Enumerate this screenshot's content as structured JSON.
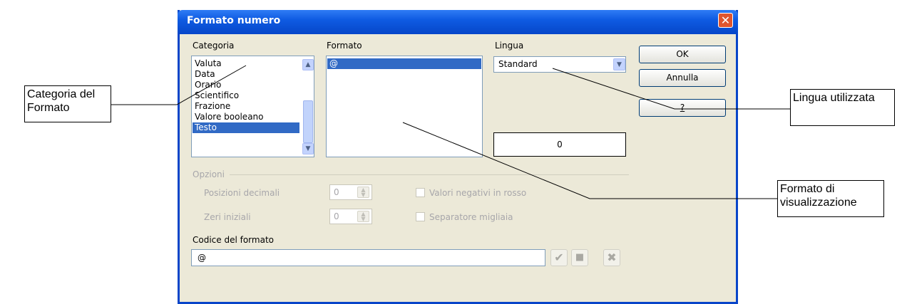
{
  "dialog": {
    "title": "Formato numero",
    "close_icon": "close-icon"
  },
  "categoria": {
    "label": "Categoria",
    "items": [
      "Valuta",
      "Data",
      "Orario",
      "Scientifico",
      "Frazione",
      "Valore booleano",
      "Testo"
    ],
    "selected": "Testo"
  },
  "formato": {
    "label": "Formato",
    "items": [
      "@"
    ],
    "selected": "@"
  },
  "lingua": {
    "label": "Lingua",
    "value": "Standard"
  },
  "preview": {
    "value": "0"
  },
  "buttons": {
    "ok": "OK",
    "cancel": "Annulla",
    "help": "?"
  },
  "opzioni": {
    "title": "Opzioni",
    "decimali_label": "Posizioni decimali",
    "decimali_value": "0",
    "zeri_label": "Zeri iniziali",
    "zeri_value": "0",
    "negativi_label": "Valori negativi in rosso",
    "migliaia_label": "Separatore migliaia"
  },
  "codice": {
    "label": "Codice del formato",
    "value": "@"
  },
  "callouts": {
    "categoria": "Categoria del Formato",
    "lingua": "Lingua utilizzata",
    "formato": "Formato di visualizzazione"
  },
  "colors": {
    "titlebar": "#0f5be2",
    "selection": "#316ac5",
    "dialog_bg": "#ece9d8",
    "close": "#e0552e",
    "confirm": "#a9a8a2"
  }
}
